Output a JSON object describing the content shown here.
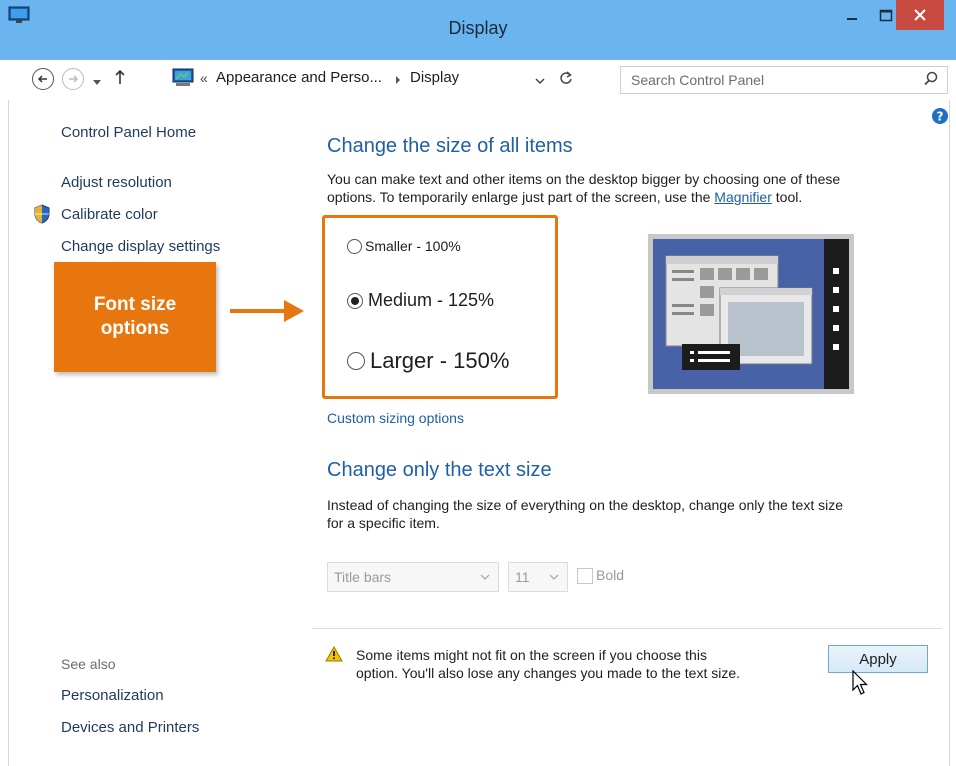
{
  "window": {
    "title": "Display"
  },
  "navbar": {
    "breadcrumb_overflow": "«",
    "breadcrumb_parent": "Appearance and Perso...",
    "breadcrumb_current": "Display",
    "search_placeholder": "Search Control Panel"
  },
  "sidebar": {
    "home": "Control Panel Home",
    "links": [
      "Adjust resolution",
      "Calibrate color",
      "Change display settings"
    ],
    "see_also_label": "See also",
    "see_also": [
      "Personalization",
      "Devices and Printers"
    ]
  },
  "callout": {
    "line1": "Font size",
    "line2": "options"
  },
  "main": {
    "heading1": "Change the size of all items",
    "desc1_a": "You can make text and other items on the desktop bigger by choosing one of these",
    "desc1_b": "options. To temporarily enlarge just part of the screen, use the",
    "magnifier_link": "Magnifier",
    "desc1_c": "tool.",
    "options": [
      {
        "label": "Smaller - 100%",
        "checked": false
      },
      {
        "label": "Medium - 125%",
        "checked": true
      },
      {
        "label": "Larger - 150%",
        "checked": false
      }
    ],
    "custom_sizing": "Custom sizing options",
    "heading2": "Change only the text size",
    "desc2_a": "Instead of changing the size of everything on the desktop, change only the text size",
    "desc2_b": "for a specific item.",
    "item_select": "Title bars",
    "size_select": "11",
    "bold_label": "Bold",
    "warning_a": "Some items might not fit on the screen if you choose this",
    "warning_b": "option. You'll also lose any changes you made to the text size.",
    "apply_label": "Apply"
  },
  "colors": {
    "titlebar": "#6ab5f0",
    "accent_orange": "#e8760e",
    "link_blue": "#1f5fa7",
    "close_red": "#c7493f"
  }
}
